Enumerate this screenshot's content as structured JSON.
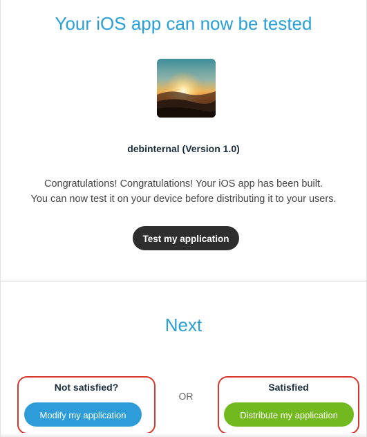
{
  "header": {
    "title": "Your iOS app can now be tested"
  },
  "app": {
    "icon": "sunset-landscape-image",
    "name": "debinternal (Version 1.0)"
  },
  "message": {
    "line1": "Congratulations! Congratulations! Your iOS app has been built.",
    "line2": "You can now test it on your device before distributing it to your users."
  },
  "actions": {
    "test_label": "Test my application"
  },
  "next": {
    "title": "Next",
    "not_satisfied_label": "Not satisfied?",
    "modify_label": "Modify my application",
    "or_label": "OR",
    "satisfied_label": "Satisfied",
    "distribute_label": "Distribute my application"
  },
  "colors": {
    "accent": "#2a9fd6",
    "dark_button": "#2e2e2e",
    "modify_button": "#2e9cd8",
    "distribute_button": "#72b91f",
    "highlight": "#d9342b"
  }
}
